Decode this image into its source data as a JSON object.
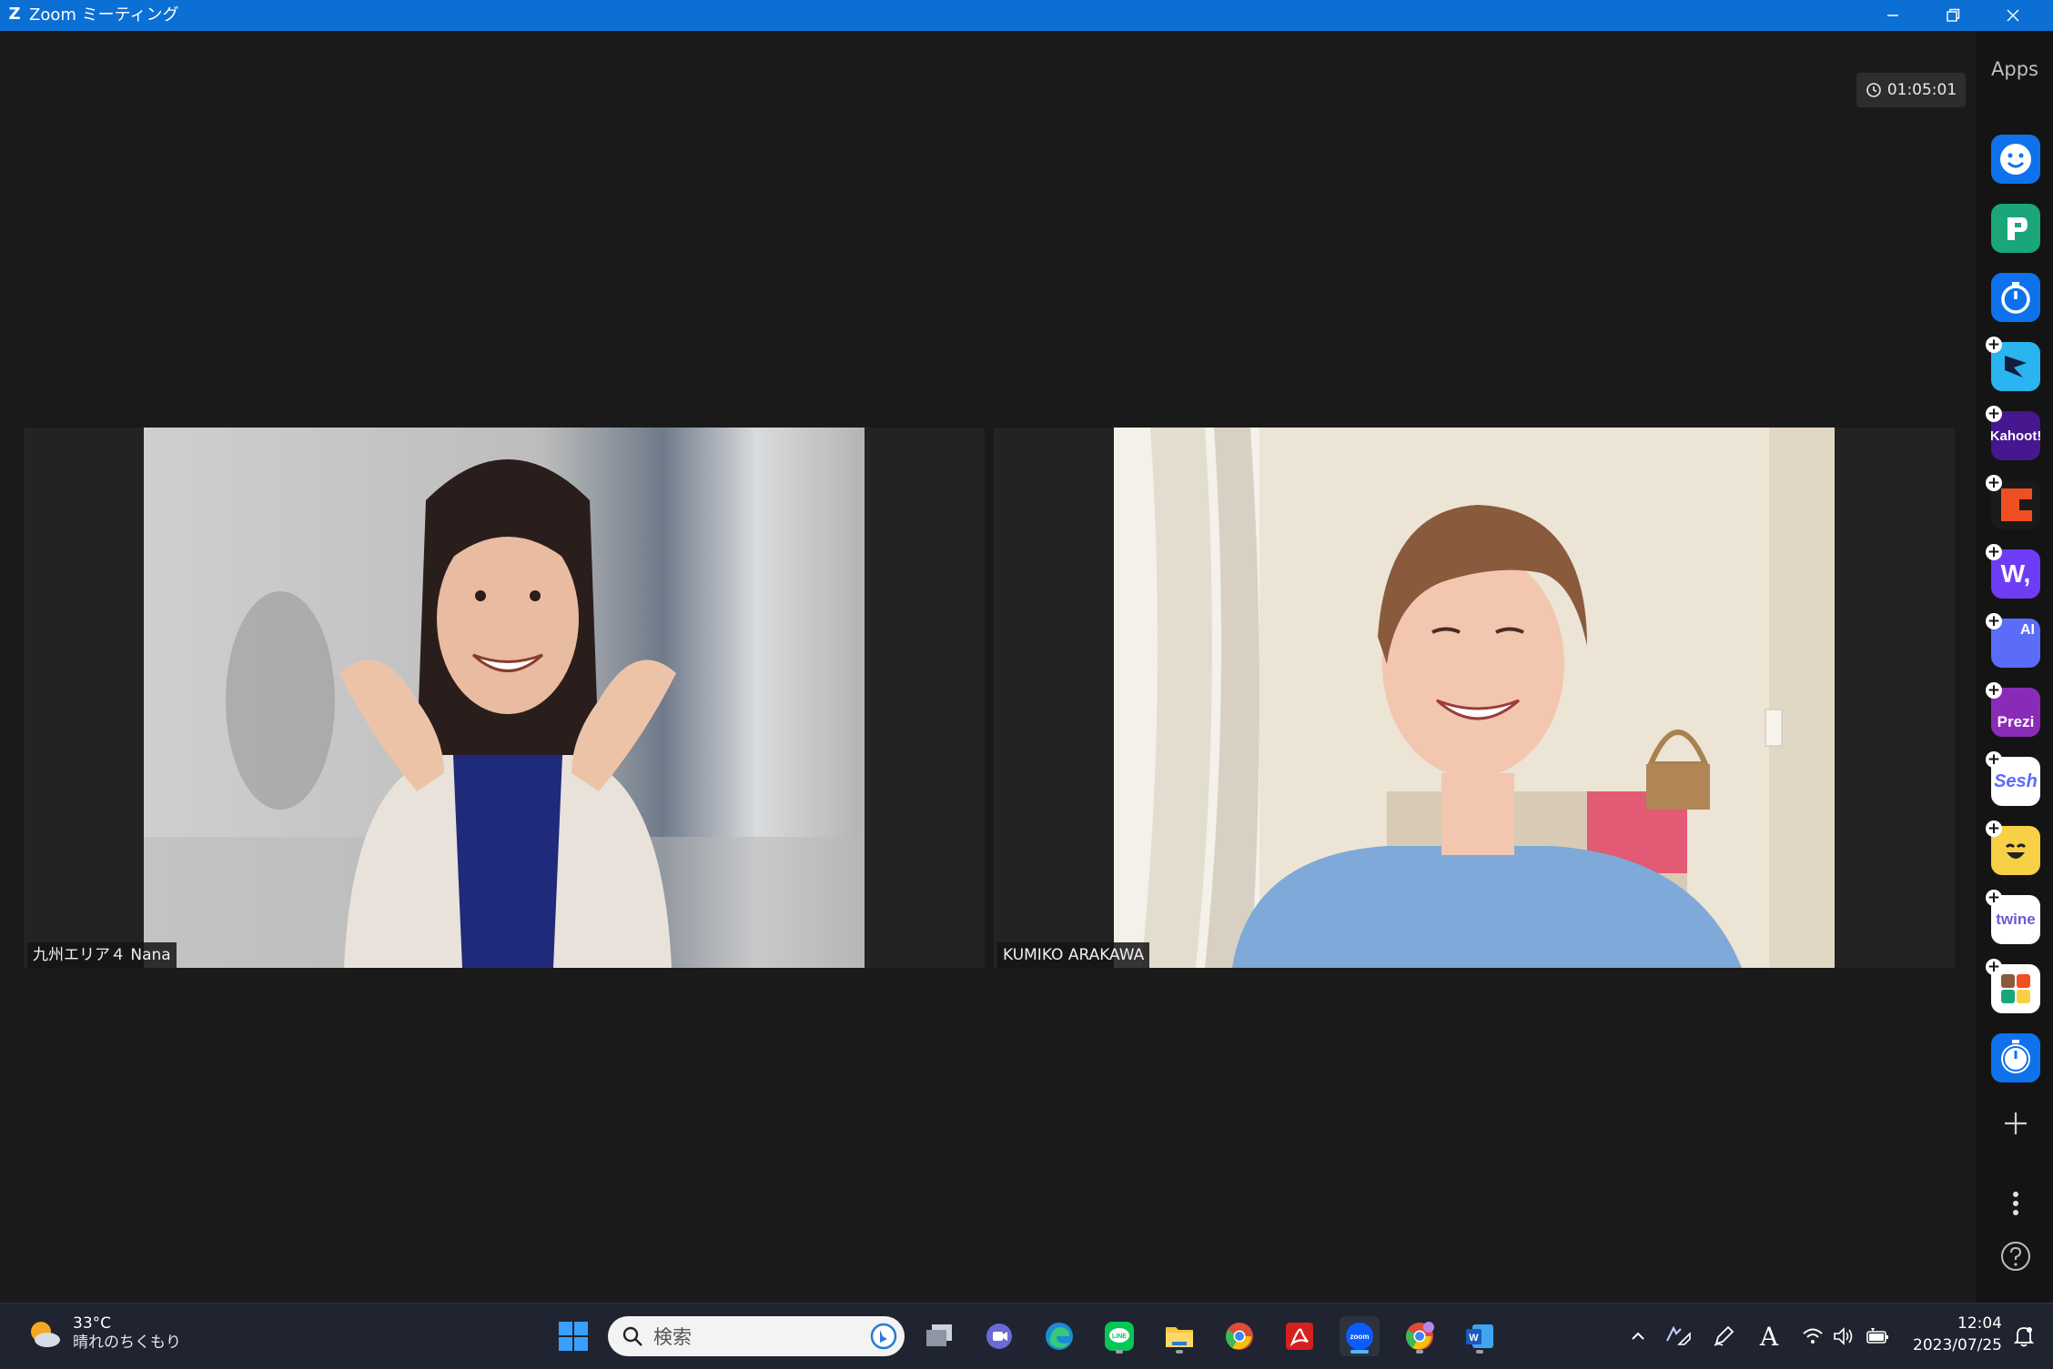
{
  "window": {
    "title": "Zoom ミーティング",
    "app_letter": "Z"
  },
  "meeting": {
    "elapsed": "01:05:01",
    "participants": [
      {
        "name": "九州エリア４ Nana"
      },
      {
        "name": "KUMIKO ARAKAWA"
      }
    ]
  },
  "apps_panel": {
    "title": "Apps",
    "apps": [
      {
        "icon": "smiley-app-icon",
        "color": "#0e72ed"
      },
      {
        "icon": "p-docs-app-icon",
        "color": "#1aa67a"
      },
      {
        "icon": "stopwatch-app-icon",
        "color": "#0e72ed"
      },
      {
        "icon": "flag-app-icon",
        "color": "#2ab4f0"
      },
      {
        "label": "Kahoot!",
        "color": "#46178f"
      },
      {
        "icon": "c-brand-app-icon",
        "color": "#f04e23"
      },
      {
        "label": "W,",
        "color": "#6d3df5"
      },
      {
        "label": "AI",
        "color": "#5b6cf8"
      },
      {
        "label": "Prezi",
        "color": "#8a2bb8"
      },
      {
        "label": "Sesh",
        "color": "#ffffff",
        "text_color": "#5b6cf8"
      },
      {
        "icon": "emoji-app-icon",
        "color": "#f7d046"
      },
      {
        "label": "twine",
        "color": "#ffffff",
        "text_color": "#6d5bd0"
      },
      {
        "icon": "blocks-app-icon",
        "color": "#ffffff"
      },
      {
        "icon": "alarm-clock-app-icon",
        "color": "#0e72ed"
      }
    ]
  },
  "taskbar": {
    "weather": {
      "temp": "33°C",
      "condition": "晴れのちくもり"
    },
    "search_placeholder": "検索",
    "clock": {
      "time": "12:04",
      "date": "2023/07/25"
    }
  }
}
